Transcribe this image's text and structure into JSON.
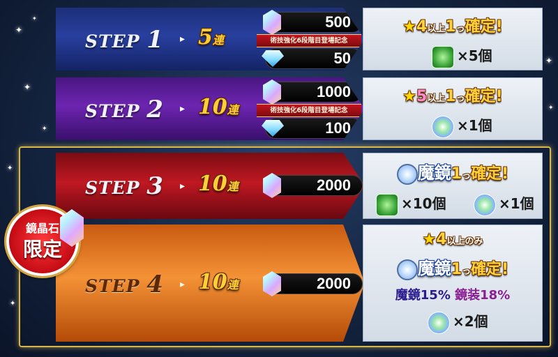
{
  "badge": {
    "line1": "鏡晶石",
    "line2": "限定"
  },
  "steps": [
    {
      "step_label": "STEP",
      "step_num": "1",
      "pull_num": "5",
      "pull_suffix": "連",
      "costs": [
        {
          "icon": "crystal-icon",
          "value": "500"
        },
        {
          "icon": "diamond-icon",
          "value": "50"
        }
      ],
      "ribbon": "術技強化6段階目登場記念",
      "guarantee": {
        "star": "★",
        "level": "4",
        "suffix": "以上",
        "count": "1",
        "unit": "っ",
        "text": "確定!"
      },
      "items": [
        {
          "icon": "green-material-icon",
          "text": "×5個"
        }
      ]
    },
    {
      "step_label": "STEP",
      "step_num": "2",
      "pull_num": "10",
      "pull_suffix": "連",
      "costs": [
        {
          "icon": "crystal-icon",
          "value": "1000"
        },
        {
          "icon": "diamond-icon",
          "value": "100"
        }
      ],
      "ribbon": "術技強化6段階目登場記念",
      "guarantee": {
        "star": "★",
        "level": "5",
        "suffix": "以上",
        "count": "1",
        "unit": "っ",
        "text": "確定!"
      },
      "items": [
        {
          "icon": "rainbow-orb-icon",
          "text": "×1個"
        }
      ]
    },
    {
      "step_label": "STEP",
      "step_num": "3",
      "pull_num": "10",
      "pull_suffix": "連",
      "costs": [
        {
          "icon": "crystal-icon",
          "value": "2000"
        }
      ],
      "guarantee": {
        "prefix": "魔鏡",
        "count": "1",
        "unit": "っ",
        "text": "確定!"
      },
      "items": [
        {
          "icon": "green-material-icon",
          "text": "×10個"
        },
        {
          "icon": "rainbow-orb-icon",
          "text": "×1個"
        }
      ]
    },
    {
      "step_label": "STEP",
      "step_num": "4",
      "pull_num": "10",
      "pull_suffix": "連",
      "costs": [
        {
          "icon": "crystal-icon",
          "value": "2000"
        }
      ],
      "top_line": {
        "star": "★",
        "level": "4",
        "text": "以上のみ"
      },
      "guarantee": {
        "prefix": "魔鏡",
        "count": "1",
        "unit": "っ",
        "text": "確定!"
      },
      "rates": {
        "a_label": "魔鏡",
        "a_value": "15",
        "a_unit": "%",
        "b_label": "鏡装",
        "b_value": "18",
        "b_unit": "%"
      },
      "items": [
        {
          "icon": "rainbow-orb-icon",
          "text": "×2個"
        }
      ]
    }
  ]
}
